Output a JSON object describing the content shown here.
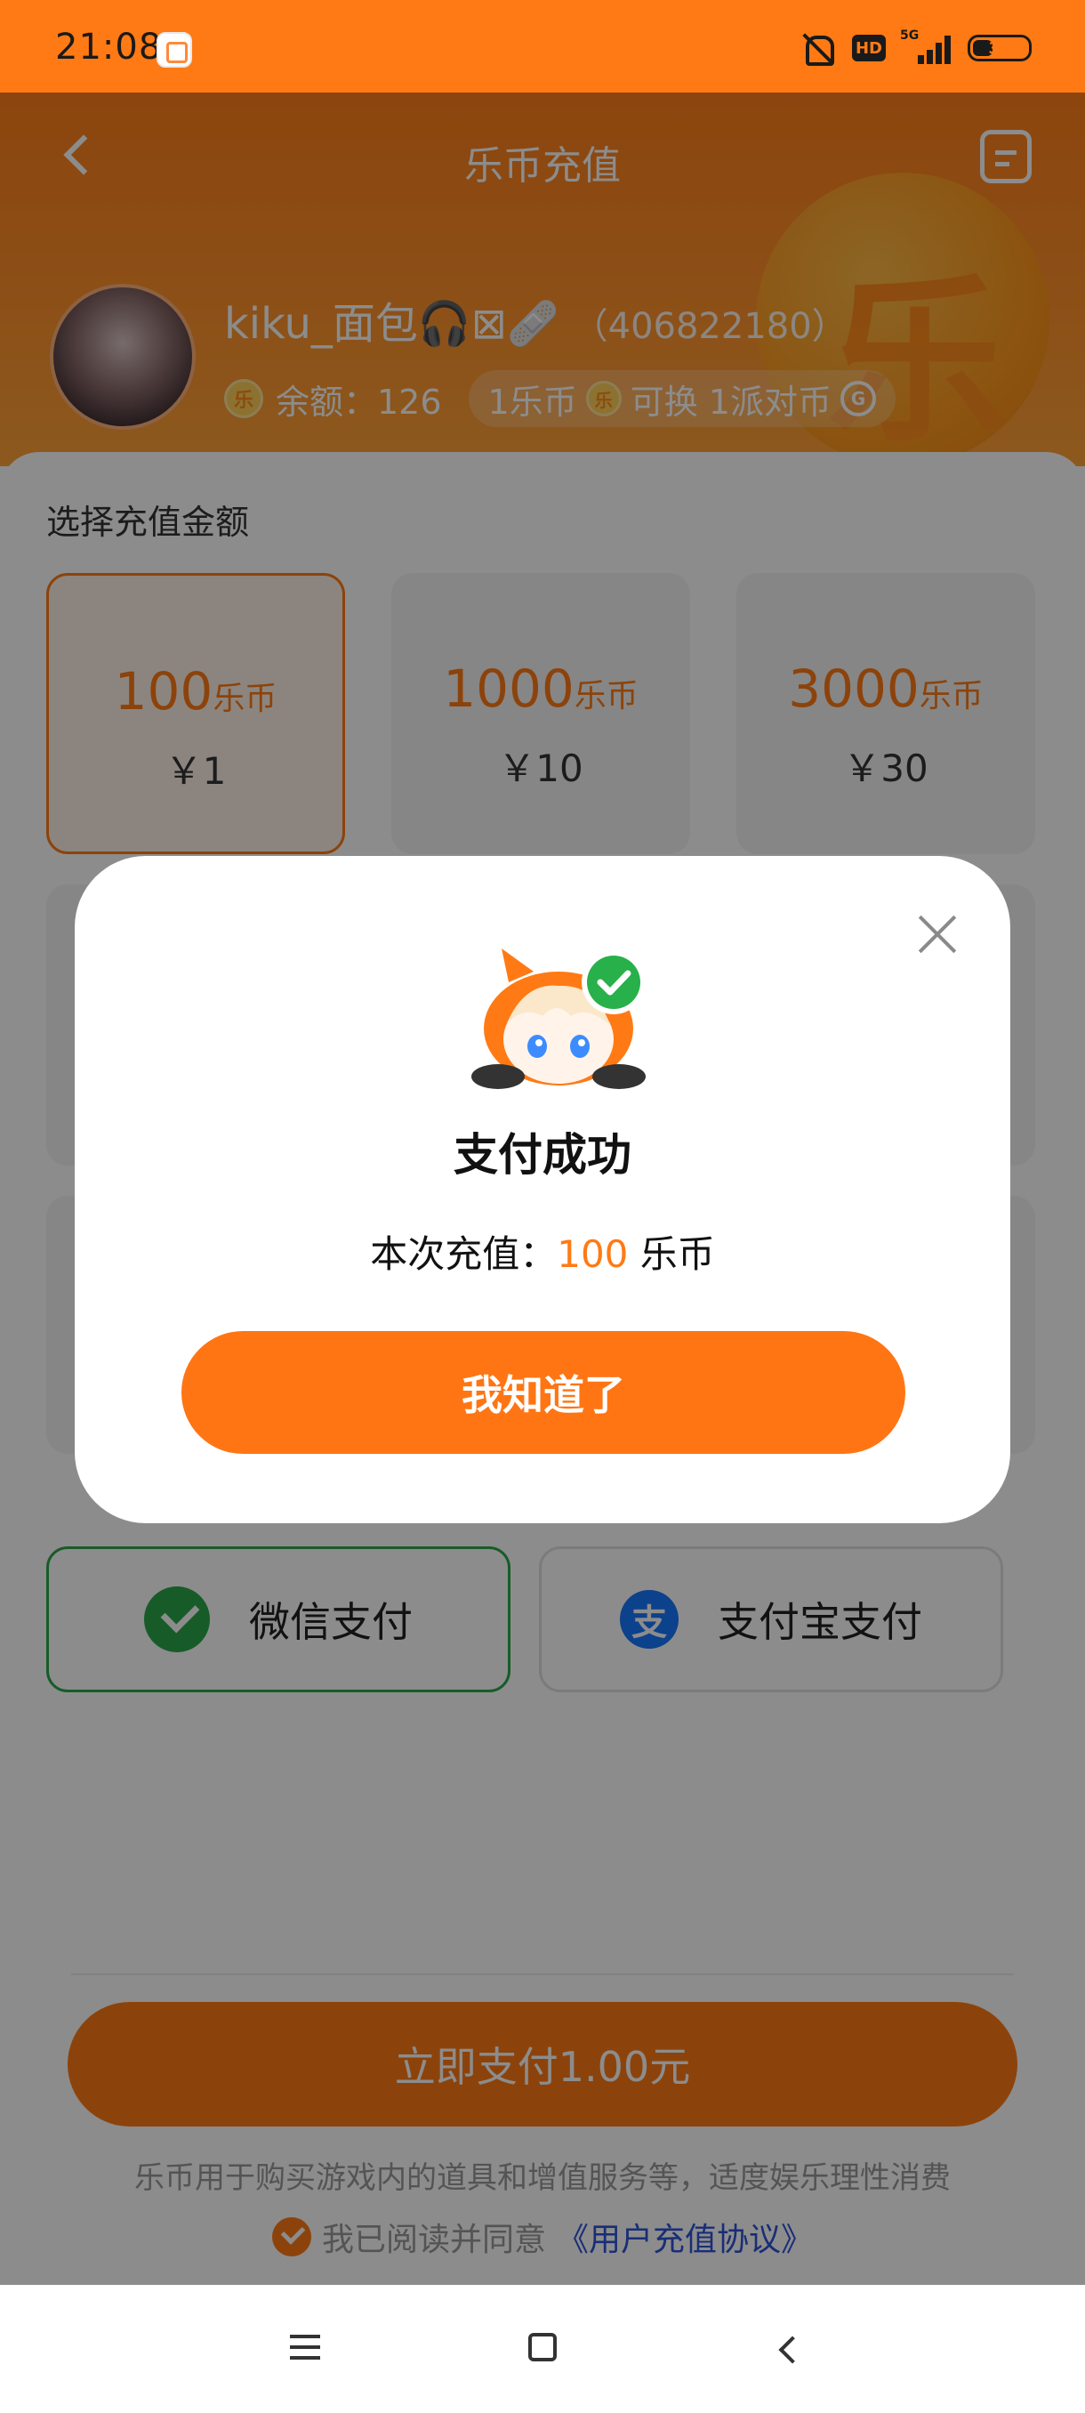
{
  "status_bar": {
    "time": "21:08",
    "hd": "HD",
    "network": "5G",
    "battery": "34"
  },
  "header": {
    "title": "乐币充值",
    "coin_deco_glyph": "乐"
  },
  "user": {
    "name": "kiku_面包🎧⊠🩹",
    "id": "（406822180）",
    "coin_icon": "乐",
    "balance_label": "余额：126",
    "exchange_prefix": "1乐币",
    "exchange_text": "可换 1派对币",
    "party_coin_icon": "G"
  },
  "recharge": {
    "section_label": "选择充值金额",
    "packages": [
      {
        "amount": "100",
        "unit": "乐币",
        "price": "￥1",
        "selected": true
      },
      {
        "amount": "1000",
        "unit": "乐币",
        "price": "￥10",
        "selected": false
      },
      {
        "amount": "3000",
        "unit": "乐币",
        "price": "￥30",
        "selected": false
      }
    ]
  },
  "payment": {
    "wechat_label": "微信支付",
    "alipay_label": "支付宝支付",
    "alipay_icon": "支",
    "pay_now_label": "立即支付1.00元",
    "notice": "乐币用于购买游戏内的道具和增值服务等，适度娱乐理性消费",
    "agree_prefix": "我已阅读并同意",
    "agree_link": "《用户充值协议》"
  },
  "modal": {
    "title": "支付成功",
    "text_prefix": "本次充值：",
    "text_amount": "100",
    "text_unit": " 乐币",
    "confirm_label": "我知道了"
  },
  "colors": {
    "accent": "#ff7a14",
    "wechat": "#2aa84a",
    "alipay": "#1677ff",
    "link": "#2f54d8"
  }
}
